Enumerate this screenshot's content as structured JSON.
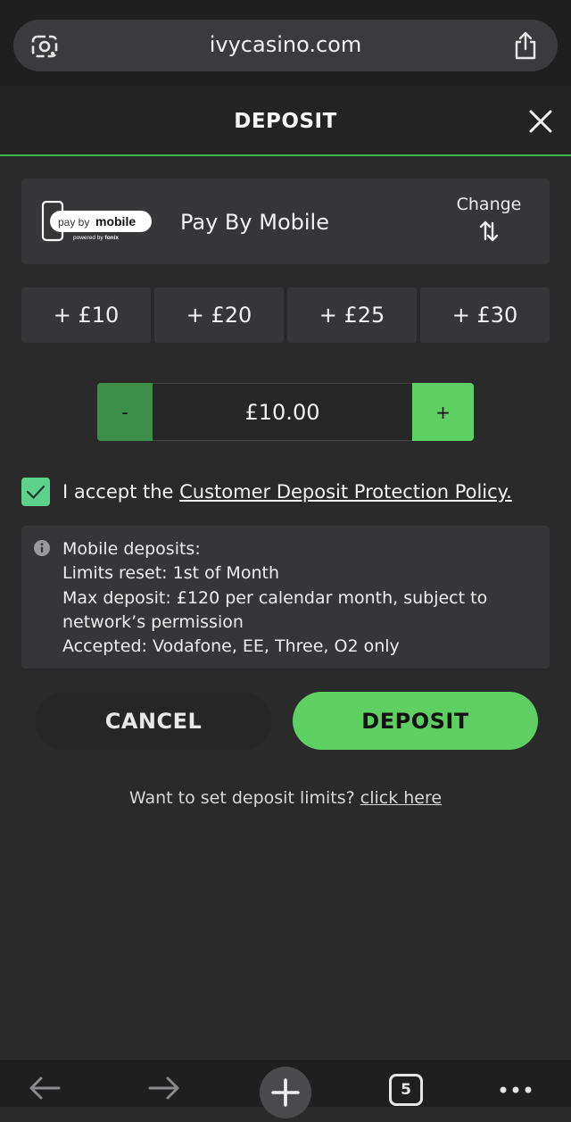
{
  "browser": {
    "url": "ivycasino.com",
    "tab_count": "5"
  },
  "modal": {
    "title": "DEPOSIT"
  },
  "payment_method": {
    "logo_text": "pay by mobile",
    "logo_subtext": "powered by fonix",
    "name": "Pay By Mobile",
    "change_label": "Change"
  },
  "quick_amounts": [
    "+ £10",
    "+ £20",
    "+ £25",
    "+ £30"
  ],
  "stepper": {
    "minus_label": "-",
    "value": "£10.00",
    "plus_label": "+"
  },
  "accept": {
    "checked": true,
    "prefix": "I accept the ",
    "link_text": "Customer Deposit Protection Policy."
  },
  "info": {
    "lines": [
      "Mobile deposits:",
      "Limits reset: 1st of Month",
      "Max deposit: £120 per calendar month, subject to",
      "network’s permission",
      "Accepted: Vodafone, EE, Three, O2 only"
    ]
  },
  "actions": {
    "cancel_label": "CANCEL",
    "deposit_label": "DEPOSIT"
  },
  "limits": {
    "prompt": "Want to set deposit limits? ",
    "link_text": "click here"
  },
  "colors": {
    "accent_green": "#5dcf63",
    "dark_green": "#3d8e49",
    "background": "#2a2a2b",
    "card": "#363638"
  }
}
